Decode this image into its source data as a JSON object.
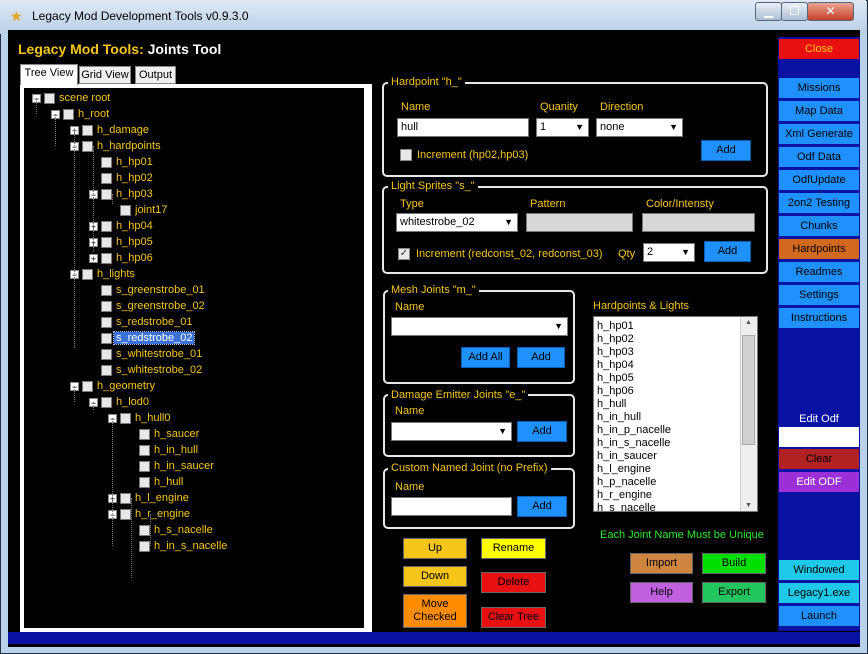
{
  "window": {
    "title": "Legacy Mod Development Tools v0.9.3.0",
    "min_icon": "minimize-icon",
    "max_icon": "maximize-icon",
    "close_icon": "close-icon"
  },
  "app": {
    "title_part1": "Legacy Mod Tools:",
    "title_part2": " Joints Tool"
  },
  "tabs": [
    "Tree View",
    "Grid View",
    "Output"
  ],
  "tree": [
    {
      "label": "scene root",
      "exp": "-"
    },
    {
      "label": "h_root",
      "exp": "-"
    },
    {
      "label": "h_damage",
      "exp": "+"
    },
    {
      "label": "h_hardpoints",
      "exp": "-"
    },
    {
      "label": "h_hp01",
      "exp": ""
    },
    {
      "label": "h_hp02",
      "exp": ""
    },
    {
      "label": "h_hp03",
      "exp": "-"
    },
    {
      "label": "joint17",
      "exp": ""
    },
    {
      "label": "h_hp04",
      "exp": "+"
    },
    {
      "label": "h_hp05",
      "exp": "+"
    },
    {
      "label": "h_hp06",
      "exp": "+"
    },
    {
      "label": "h_lights",
      "exp": "-"
    },
    {
      "label": "s_greenstrobe_01",
      "exp": ""
    },
    {
      "label": "s_greenstrobe_02",
      "exp": ""
    },
    {
      "label": "s_redstrobe_01",
      "exp": ""
    },
    {
      "label": "s_redstrobe_02",
      "exp": ""
    },
    {
      "label": "s_whitestrobe_01",
      "exp": ""
    },
    {
      "label": "s_whitestrobe_02",
      "exp": ""
    },
    {
      "label": "h_geometry",
      "exp": "-"
    },
    {
      "label": "h_lod0",
      "exp": "-"
    },
    {
      "label": "h_hull0",
      "exp": "-"
    },
    {
      "label": "h_saucer",
      "exp": ""
    },
    {
      "label": "h_in_hull",
      "exp": ""
    },
    {
      "label": "h_in_saucer",
      "exp": ""
    },
    {
      "label": "h_hull",
      "exp": ""
    },
    {
      "label": "h_l_engine",
      "exp": "+"
    },
    {
      "label": "h_r_engine",
      "exp": "-"
    },
    {
      "label": "h_s_nacelle",
      "exp": ""
    },
    {
      "label": "h_in_s_nacelle",
      "exp": ""
    }
  ],
  "hardpoint": {
    "legend": "Hardpoint \"h_\"",
    "name_label": "Name",
    "name_value": "hull",
    "quantity_label": "Quanity",
    "quantity_value": "1",
    "direction_label": "Direction",
    "direction_value": "none",
    "increment_label": "Increment (hp02,hp03)",
    "increment_checked": false,
    "add_label": "Add"
  },
  "lights": {
    "legend": "Light Sprites \"s_\"",
    "type_label": "Type",
    "type_value": "whitestrobe_02",
    "pattern_label": "Pattern",
    "color_label": "Color/Intensty",
    "increment_label": "Increment (redconst_02, redconst_03)",
    "increment_checked": true,
    "qty_label": "Qty",
    "qty_value": "2",
    "add_label": "Add"
  },
  "mesh": {
    "legend": "Mesh Joints \"m_\"",
    "name_label": "Name",
    "add_all_label": "Add All",
    "add_label": "Add"
  },
  "damage": {
    "legend": "Damage Emitter Joints \"e_\"",
    "name_label": "Name",
    "add_label": "Add"
  },
  "custom": {
    "legend": "Custom Named Joint (no Prefix)",
    "name_label": "Name",
    "add_label": "Add"
  },
  "list": {
    "label": "Hardpoints & Lights",
    "items": [
      "h_hp01",
      "h_hp02",
      "h_hp03",
      "h_hp04",
      "h_hp05",
      "h_hp06",
      "h_hull",
      "h_in_hull",
      "h_in_p_nacelle",
      "h_in_s_nacelle",
      "h_in_saucer",
      "h_l_engine",
      "h_p_nacelle",
      "h_r_engine",
      "h_s_nacelle"
    ]
  },
  "notice": "Each Joint Name Must be Unique",
  "actions": {
    "up": "Up",
    "rename": "Rename",
    "down": "Down",
    "delete": "Delete",
    "move_checked": "Move Checked",
    "clear_tree": "Clear Tree",
    "import": "Import",
    "build": "Build",
    "help": "Help",
    "export": "Export"
  },
  "sidebar": {
    "close": "Close",
    "items": [
      "Missions",
      "Map Data",
      "Xml Generate",
      "Odf Data",
      "OdfUpdate",
      "2on2 Testing",
      "Chunks",
      "Hardpoints",
      "Readmes",
      "Settings",
      "Instructions"
    ],
    "active": "Hardpoints",
    "edit_odf_label": "Edit Odf",
    "clear": "Clear",
    "edit_odf_btn": "Edit ODF",
    "windowed": "Windowed",
    "legacy_exe": "Legacy1.exe",
    "launch": "Launch"
  },
  "colors": {
    "accent_yellow": "#f5c518",
    "button_blue": "#1e90ff",
    "sidebar_navy": "#0a12a3",
    "close_red": "#e81010"
  }
}
